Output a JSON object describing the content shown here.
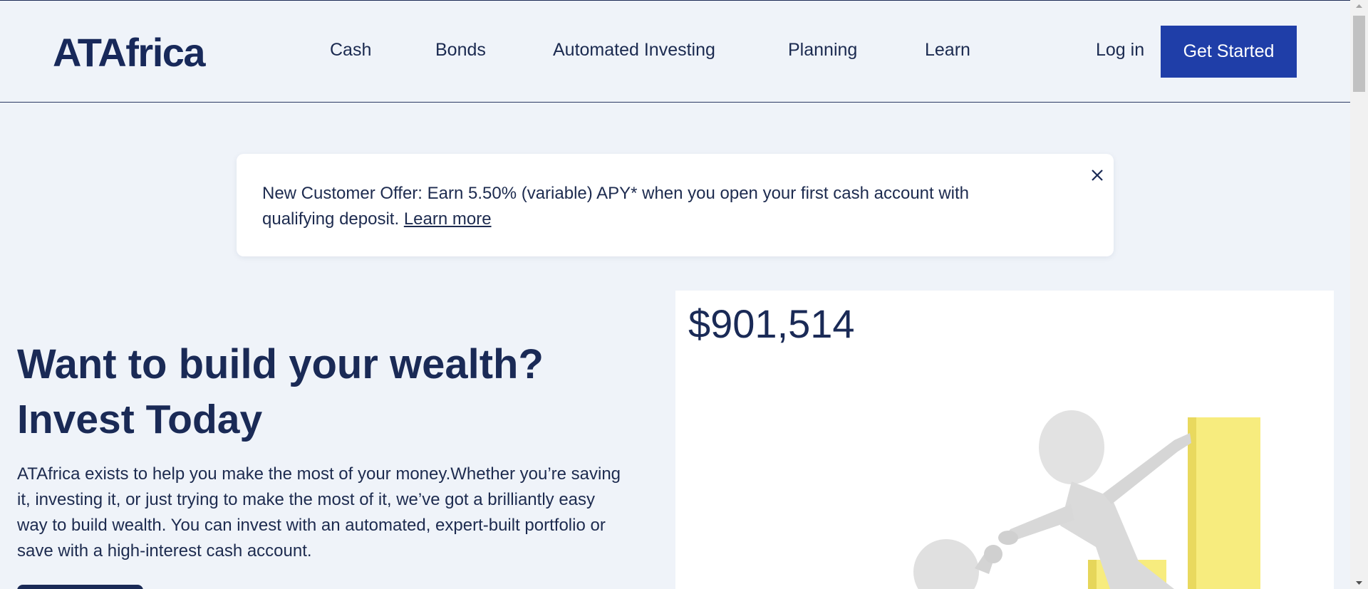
{
  "header": {
    "logo": "ATAfrica",
    "nav": [
      {
        "label": "Cash"
      },
      {
        "label": "Bonds"
      },
      {
        "label": "Automated Investing"
      },
      {
        "label": "Planning"
      },
      {
        "label": "Learn"
      }
    ],
    "login_label": "Log in",
    "cta_label": "Get Started"
  },
  "banner": {
    "text": "New Customer Offer: Earn 5.50% (variable) APY* when you open your first cash account with qualifying deposit.",
    "link_label": "Learn more",
    "close_icon": "close-icon"
  },
  "hero": {
    "line1": "Want to build your wealth?",
    "line2": "Invest Today",
    "body": "ATAfrica exists to help you make the most of your money.Whether you’re saving it, investing it, or just trying to make the most of it, we’ve got a brilliantly easy way to build wealth. You can invest with an automated, expert-built portfolio or save with a high-interest cash account."
  },
  "card": {
    "amount": "$901,514",
    "illustration": "figures-climbing-bar-chart"
  },
  "colors": {
    "page_bg": "#eff3f9",
    "brand_navy": "#1a2a56",
    "cta_blue": "#1f3ea8",
    "bar_yellow": "#f7ec7e"
  }
}
